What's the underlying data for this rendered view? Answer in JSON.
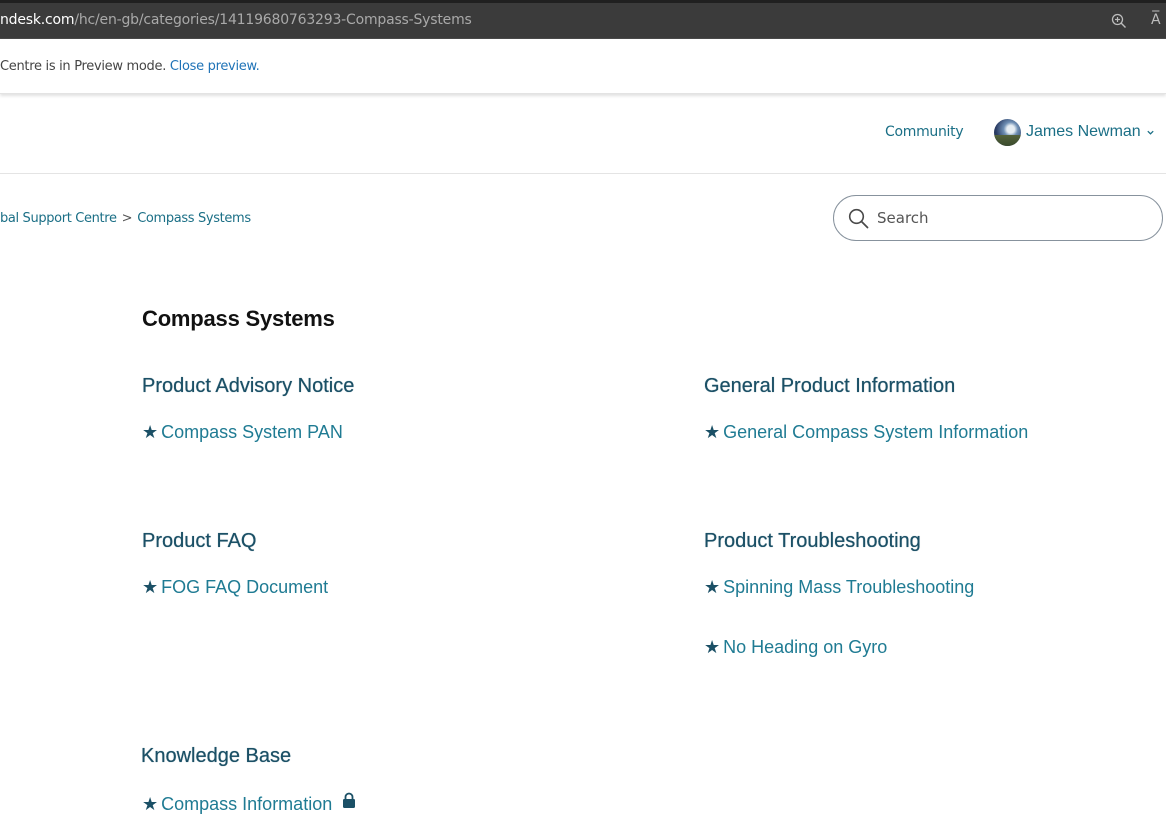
{
  "browser": {
    "url_host": "ndesk.com",
    "url_path": "/hc/en-gb/categories/14119680763293-Compass-Systems",
    "read_aloud_label": "A̅"
  },
  "preview": {
    "text": "Centre is in Preview mode.",
    "close_label": "Close preview."
  },
  "header": {
    "community_label": "Community",
    "user_name": "James Newman"
  },
  "breadcrumb": {
    "items": [
      "bal Support Centre",
      "Compass Systems"
    ],
    "separator": ">"
  },
  "search": {
    "placeholder": "Search"
  },
  "page": {
    "title": "Compass Systems"
  },
  "sections": [
    {
      "title": "Product Advisory Notice",
      "articles": [
        "Compass System PAN"
      ]
    },
    {
      "title": "General Product Information",
      "articles": [
        "General Compass System Information"
      ]
    },
    {
      "title": "Product FAQ",
      "articles": [
        "FOG FAQ Document"
      ]
    },
    {
      "title": "Product Troubleshooting",
      "articles": [
        "Spinning Mass Troubleshooting",
        "No Heading on Gyro"
      ]
    },
    {
      "title": "Knowledge Base",
      "articles": [
        "Compass Information"
      ]
    }
  ],
  "star_glyph": "★",
  "colors": {
    "link": "#1f7b93",
    "section_title": "#1b5066",
    "preview_link": "#1f73b7"
  }
}
